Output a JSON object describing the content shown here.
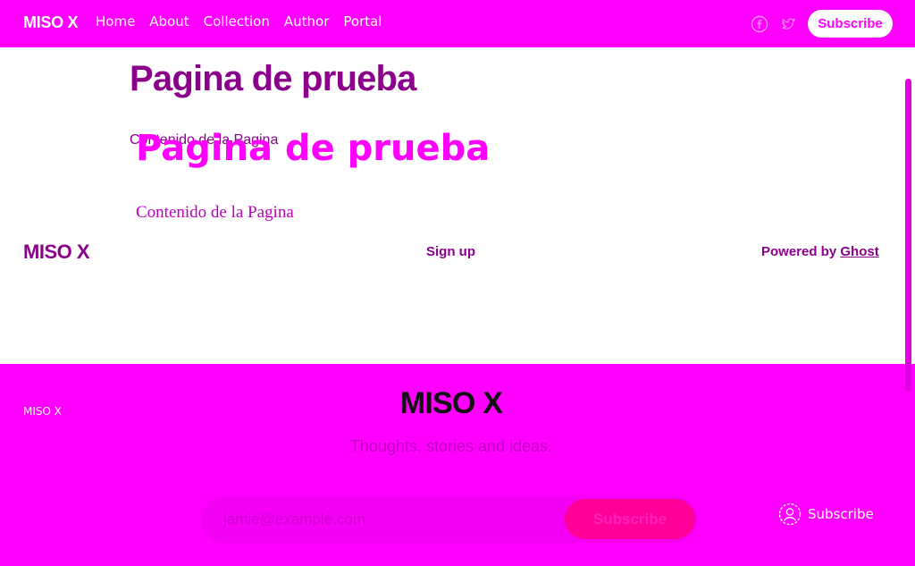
{
  "header": {
    "brand": "MISO X",
    "nav": [
      "Home",
      "About",
      "Collection",
      "Author",
      "Portal"
    ],
    "social_icons": [
      "facebook-icon",
      "twitter-icon"
    ],
    "subscribe_label": "Subscribe"
  },
  "article": {
    "title": "Pagina de prueba",
    "content": "Contenido de la Pagina",
    "title_overlay": "Pagina de prueba",
    "content_overlay": "Contenido de la Pagina"
  },
  "footer": {
    "brand": "MISO X",
    "signup": "Sign up",
    "powered_prefix": "Powered by ",
    "powered_link": "Ghost"
  },
  "cta": {
    "small_brand": "MISO X",
    "brand": "MISO X",
    "tagline": "Thoughts, stories and ideas.",
    "email_placeholder": "jamie@example.com",
    "button_label": "Subscribe",
    "portal_label": "Subscribe",
    "portal_icon": "user-circle-icon"
  },
  "colors": {
    "accent": "#ff00ff",
    "text_dark_accent": "#8b008b",
    "button_pink": "#ff0099"
  }
}
